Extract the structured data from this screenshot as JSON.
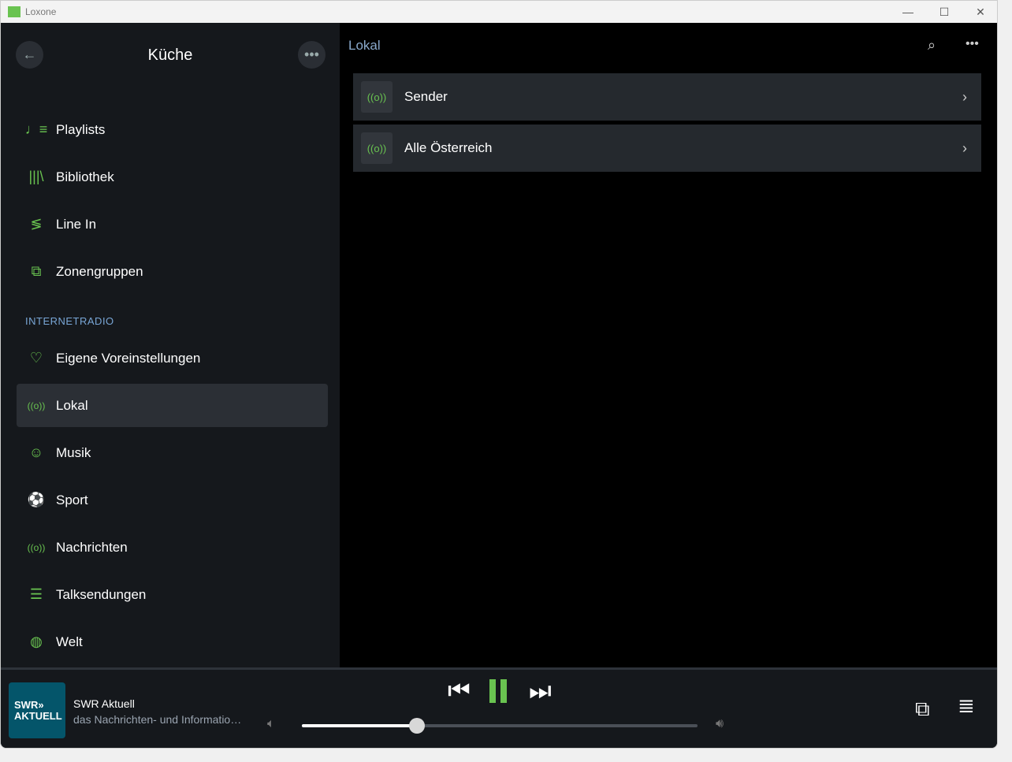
{
  "window": {
    "title": "Loxone",
    "minimize": "—",
    "maximize": "☐",
    "close": "✕"
  },
  "sidebar": {
    "title": "Küche",
    "section": "INTERNETRADIO",
    "items": [
      {
        "label": "Playlists",
        "icon": "♩≡"
      },
      {
        "label": "Bibliothek",
        "icon": "|||\\"
      },
      {
        "label": "Line In",
        "icon": "≶"
      },
      {
        "label": "Zonengruppen",
        "icon": "⧉"
      }
    ],
    "radio": [
      {
        "label": "Eigene Voreinstellungen",
        "icon": "♡"
      },
      {
        "label": "Lokal",
        "icon": "((o))"
      },
      {
        "label": "Musik",
        "icon": "☺"
      },
      {
        "label": "Sport",
        "icon": "⚽"
      },
      {
        "label": "Nachrichten",
        "icon": "((o))"
      },
      {
        "label": "Talksendungen",
        "icon": "☰"
      },
      {
        "label": "Welt",
        "icon": "◍"
      }
    ]
  },
  "main": {
    "title": "Lokal",
    "rows": [
      {
        "label": "Sender",
        "icon": "((o))"
      },
      {
        "label": "Alle Österreich",
        "icon": "((o))"
      }
    ]
  },
  "player": {
    "cover_line1": "SWR»",
    "cover_line2": "AKTUELL",
    "station": "SWR Aktuell",
    "subtitle": "das Nachrichten- und Informatio…",
    "volume": 0.29,
    "accent": "#69c350"
  }
}
